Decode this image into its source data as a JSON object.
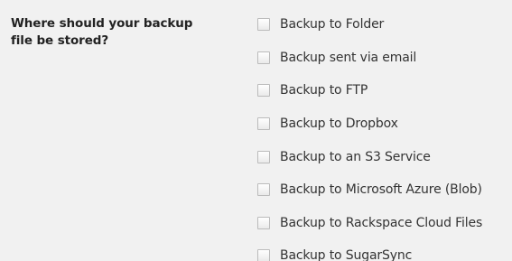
{
  "question": {
    "line1": "Where should your backup",
    "line2": "file be stored?"
  },
  "options": [
    {
      "label": "Backup to Folder",
      "checked": false
    },
    {
      "label": "Backup sent via email",
      "checked": false
    },
    {
      "label": "Backup to FTP",
      "checked": false
    },
    {
      "label": "Backup to Dropbox",
      "checked": false
    },
    {
      "label": "Backup to an S3 Service",
      "checked": false
    },
    {
      "label": "Backup to Microsoft Azure (Blob)",
      "checked": false
    },
    {
      "label": "Backup to Rackspace Cloud Files",
      "checked": false
    },
    {
      "label": "Backup to SugarSync",
      "checked": false
    }
  ]
}
